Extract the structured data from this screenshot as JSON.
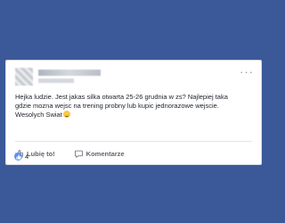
{
  "post": {
    "author_name": "",
    "timestamp": "",
    "text_lines": [
      "Hejka ludzie. Jest jakas silka otwarta 25-26 grudnia w zs? Najlepiej taka",
      "gdzie mozna wejsc na trening probny lub kupic jednorazowe wejscie.",
      "Wesolych Swiat"
    ],
    "menu_icon": "more-horizontal-icon"
  },
  "actions": {
    "like_label": "Lubię to!",
    "comment_label": "Komentarze"
  },
  "reactions": {
    "count": "4",
    "icon": "like-icon"
  },
  "colors": {
    "background": "#3b5998",
    "card": "#ffffff",
    "text": "#1d2129",
    "secondary_text": "#606770",
    "like_blue": "#5890ff"
  }
}
